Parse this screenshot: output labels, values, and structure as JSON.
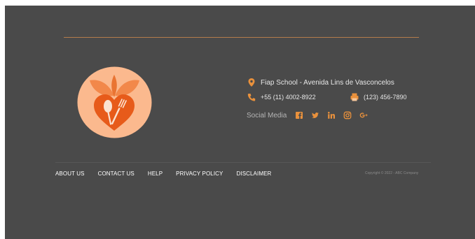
{
  "footer": {
    "address": "Fiap School - Avenida Lins de Vasconcelos",
    "phone": "+55 (11) 4002-8922",
    "fax": "(123) 456-7890",
    "social_label": "Social Media",
    "social_icons": [
      "facebook-icon",
      "twitter-icon",
      "linkedin-icon",
      "instagram-icon",
      "google-plus-icon"
    ],
    "nav": [
      "ABOUT US",
      "CONTACT US",
      "HELP",
      "PRIVACY POLICY",
      "DISCLAIMER"
    ],
    "copyright": "Copyright © 2022 - ABC Company"
  },
  "colors": {
    "background": "#4a4a4a",
    "accent": "#e9913c",
    "rule": "#b57d4c",
    "logo_circle": "#fbb98e",
    "logo_heart": "#e75b1a"
  }
}
